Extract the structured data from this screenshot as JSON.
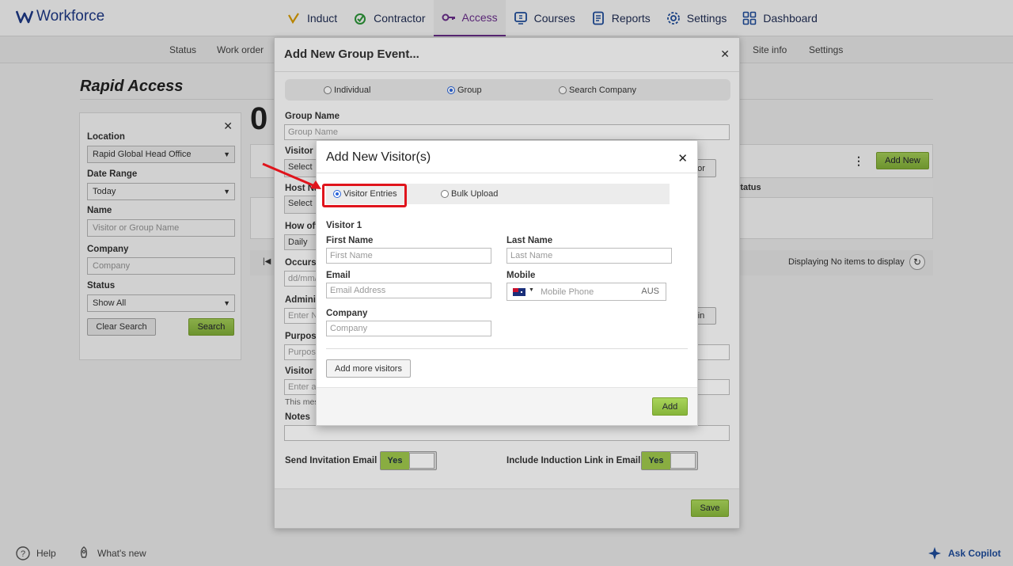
{
  "app": {
    "name": "Workforce"
  },
  "nav": [
    {
      "label": "Induct",
      "icon": "induct-icon",
      "active": false
    },
    {
      "label": "Contractor",
      "icon": "contractor-icon",
      "active": false
    },
    {
      "label": "Access",
      "icon": "key-icon",
      "active": true
    },
    {
      "label": "Courses",
      "icon": "courses-icon",
      "active": false
    },
    {
      "label": "Reports",
      "icon": "reports-icon",
      "active": false
    },
    {
      "label": "Settings",
      "icon": "gear-icon",
      "active": false
    },
    {
      "label": "Dashboard",
      "icon": "dashboard-icon",
      "active": false
    }
  ],
  "subnav": {
    "status": "Status",
    "work_order": "Work order",
    "site_info": "Site info",
    "settings": "Settings"
  },
  "page": {
    "title": "Rapid Access",
    "count": "0"
  },
  "filter": {
    "location_label": "Location",
    "location_value": "Rapid Global Head Office",
    "date_label": "Date Range",
    "date_value": "Today",
    "name_label": "Name",
    "name_placeholder": "Visitor or Group Name",
    "company_label": "Company",
    "company_placeholder": "Company",
    "status_label": "Status",
    "status_value": "Show All",
    "clear": "Clear Search",
    "search": "Search"
  },
  "grid": {
    "add_new": "Add New",
    "col_status": "Status",
    "pager_text": "Displaying No items to display"
  },
  "group_dialog": {
    "title": "Add New Group Event...",
    "radio_individual": "Individual",
    "radio_group": "Group",
    "radio_search": "Search Company",
    "group_name_label": "Group Name",
    "group_name_placeholder": "Group Name",
    "visitor_label": "Visitor L",
    "select1": "Select",
    "host_label": "Host Na",
    "select2": "Select",
    "how_often_label": "How ofte",
    "how_often_value": "Daily",
    "occurs_label": "Occurs",
    "occurs_placeholder": "dd/mm/",
    "admin_label": "Adminis",
    "admin_placeholder": "Enter N",
    "purpose_label": "Purpose",
    "purpose_placeholder": "Purpose",
    "visitor_msg_label": "Visitor m",
    "visitor_msg_placeholder": "Enter a",
    "msg_hint": "This mes",
    "notes_label": "Notes",
    "side_btn_1": "or",
    "side_btn_2": "in",
    "send_invite_label": "Send Invitation Email",
    "send_invite_toggle": "Yes",
    "include_induction_label": "Include Induction Link in Email",
    "include_induction_toggle": "Yes",
    "save": "Save"
  },
  "visitor_dialog": {
    "title": "Add New Visitor(s)",
    "tab_entries": "Visitor Entries",
    "tab_bulk": "Bulk Upload",
    "section": "Visitor 1",
    "first_name_label": "First Name",
    "first_name_placeholder": "First Name",
    "last_name_label": "Last Name",
    "last_name_placeholder": "Last Name",
    "email_label": "Email",
    "email_placeholder": "Email Address",
    "mobile_label": "Mobile",
    "mobile_placeholder": "Mobile Phone",
    "mobile_country": "AUS",
    "company_label": "Company",
    "company_placeholder": "Company",
    "add_more": "Add more visitors",
    "add": "Add"
  },
  "bottom": {
    "help": "Help",
    "whats_new": "What's new",
    "copilot": "Ask Copilot"
  },
  "colors": {
    "accent": "#6d2f8f",
    "brand": "#1e3a8a",
    "green": "#9dc54a",
    "highlight": "#e0141c"
  }
}
